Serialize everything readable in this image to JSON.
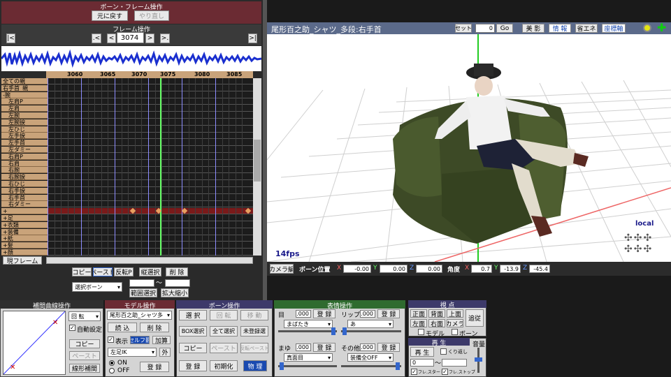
{
  "frame_panel": {
    "title": "ボーン・フレーム操作",
    "undo": "元に戻す",
    "redo": "やり直し",
    "frame_ops_title": "フレーム操作",
    "first": "|<",
    "prev_key": ".<",
    "prev": "<",
    "frame_value": "3074",
    "next": ">",
    "next_key": ">.",
    "last": ">|",
    "ruler": [
      "3060",
      "3065",
      "3070",
      "3075",
      "3080",
      "3085"
    ],
    "tracks": [
      "全ての親",
      "右手首_親",
      "-腕",
      "左肩P",
      "左肩",
      "左腕",
      "左腕捩",
      "左ひじ",
      "左手捩",
      "左手首",
      "左ダミー",
      "右肩P",
      "右肩",
      "右腕",
      "右腕捩",
      "右ひじ",
      "右手捩",
      "右手首",
      "右ダミー",
      "+",
      "+足",
      "+衣類",
      "+装備",
      "+紙",
      "+髪",
      "+顔"
    ],
    "current_frame_tab": "現フレーム",
    "copy": "コピー",
    "paste": "ペースト",
    "reverse_paste": "反転P",
    "select_range": "縦選択",
    "delete": "削 除",
    "selected_bone": "選択ボーン",
    "range_select": "範囲選択",
    "expand_shrink": "拡大縮小",
    "tilde": "～"
  },
  "viewport": {
    "title": "尾形百之助_シャツ_多段:右手首",
    "set": "セット",
    "set_value": "0",
    "go": "Go",
    "shadow": "美 影",
    "info": "情 報",
    "energy": "省エネ",
    "axis": "座標軸",
    "fps": "14fps",
    "local": "local",
    "camera_tab": "カメラ編",
    "bone_pos": "ボーン位置",
    "x": "X",
    "y": "Y",
    "z": "Z",
    "pos_x": "-0.00",
    "pos_y": "0.00",
    "pos_z": "0.00",
    "angle": "角度",
    "ang_x": "0.7",
    "ang_y": "-13.9",
    "ang_z": "-45.4"
  },
  "interp": {
    "title": "補間曲線操作",
    "rotate": "回 転",
    "auto": "自動設定",
    "copy": "コピー",
    "paste": "ペースト",
    "linear": "線形補間"
  },
  "model": {
    "title": "モデル操作",
    "model_name": "尾形百之助_シャツ多",
    "load": "読 込",
    "delete": "削 除",
    "display": "表示",
    "self_shadow": "セルフ影",
    "add": "加算",
    "bone_sel": "左足IK",
    "outside": "外",
    "on": "ON",
    "off": "OFF",
    "register": "登 録"
  },
  "bone": {
    "title": "ボーン操作",
    "select": "選 択",
    "rotate": "回 転",
    "move": "移 動",
    "box": "BOX選択",
    "all": "全て選択",
    "unregistered": "未登録選",
    "copy": "コピー",
    "paste": "ペースト",
    "rev_paste": "反転ペースト",
    "register": "登 録",
    "init": "初期化",
    "physics": "物 理"
  },
  "morph": {
    "title": "表情操作",
    "eye": "目",
    "eye_val": "1.000",
    "lip": "リップ",
    "lip_val": "0.000",
    "register": "登 録",
    "eye_sel": "まばたき",
    "lip_sel": "あ",
    "brow": "まゆ",
    "brow_val": "0.000",
    "other": "その他",
    "other_val": "1.000",
    "brow_sel": "真面目",
    "other_sel": "装備全OFF"
  },
  "view": {
    "title": "視 点",
    "front": "正面",
    "back": "背面",
    "top": "上面",
    "follow": "追従",
    "left": "左面",
    "right": "右面",
    "camera": "カメラ",
    "model": "モデル",
    "bone": "ボーン"
  },
  "play": {
    "title": "再 生",
    "play": "再 生",
    "repeat": "くり返し",
    "from": "0",
    "tilde": "～",
    "frame_stop": "フレ.ストップ",
    "frame_start": "フレ.スタート",
    "volume": "音量"
  }
}
